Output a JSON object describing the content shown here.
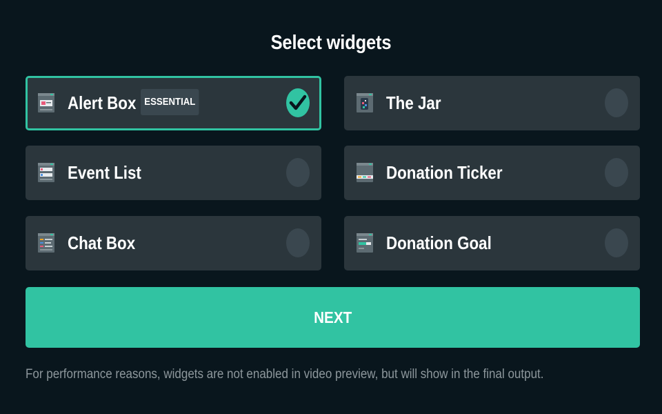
{
  "page": {
    "title": "Select widgets",
    "note": "For performance reasons, widgets are not enabled in video preview, but will show in the final output."
  },
  "widgets": [
    {
      "label": "Alert Box",
      "badge": "ESSENTIAL",
      "selected": true,
      "icon": "alert-box-widget-icon"
    },
    {
      "label": "The Jar",
      "selected": false,
      "icon": "the-jar-widget-icon"
    },
    {
      "label": "Event List",
      "selected": false,
      "icon": "event-list-widget-icon"
    },
    {
      "label": "Donation Ticker",
      "selected": false,
      "icon": "donation-ticker-widget-icon"
    },
    {
      "label": "Chat Box",
      "selected": false,
      "icon": "chat-box-widget-icon"
    },
    {
      "label": "Donation Goal",
      "selected": false,
      "icon": "donation-goal-widget-icon"
    }
  ],
  "actions": {
    "next_label": "NEXT"
  },
  "colors": {
    "background": "#09161d",
    "card": "#2b363c",
    "accent": "#31c3a2",
    "radio_off": "#3a474f",
    "note_text": "#8d979c"
  }
}
